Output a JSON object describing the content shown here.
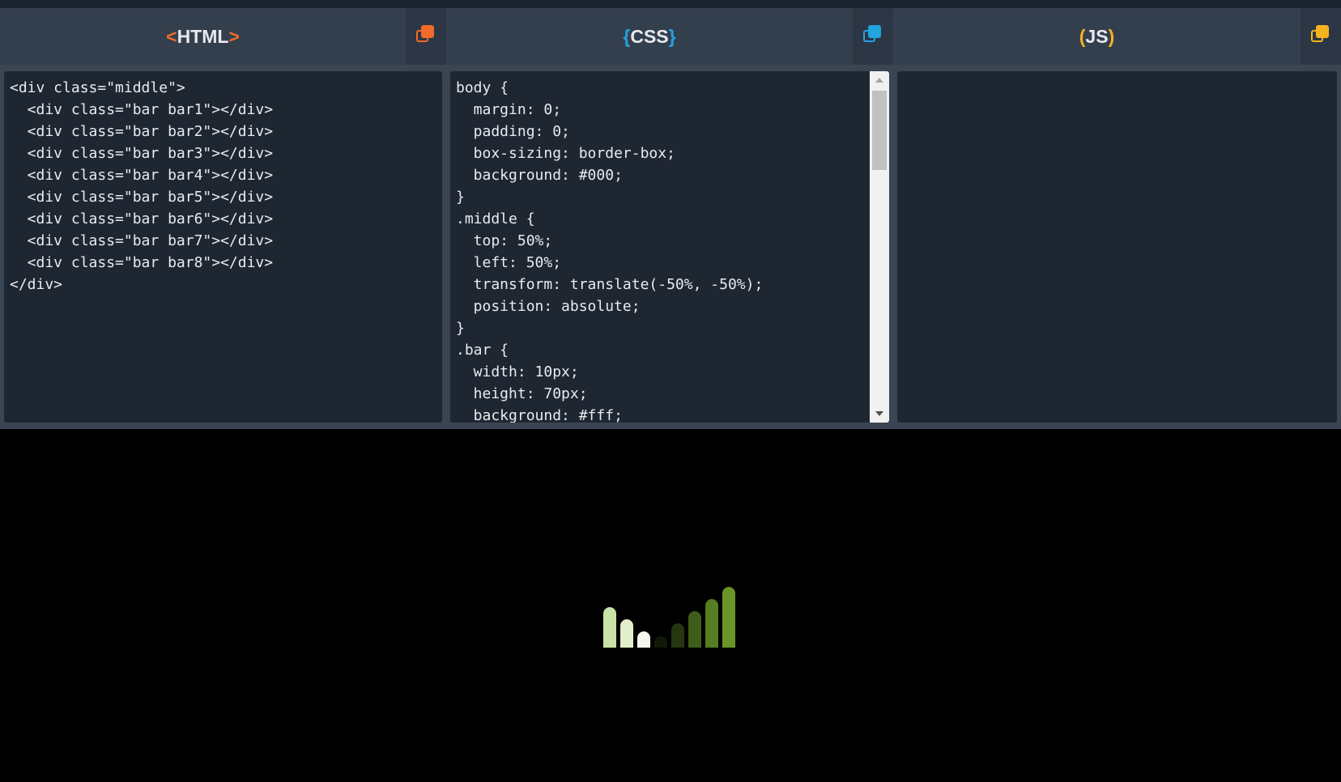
{
  "editors": {
    "html": {
      "title_open": "<",
      "title": "HTML",
      "title_close": ">",
      "code": "<div class=\"middle\">\n  <div class=\"bar bar1\"></div>\n  <div class=\"bar bar2\"></div>\n  <div class=\"bar bar3\"></div>\n  <div class=\"bar bar4\"></div>\n  <div class=\"bar bar5\"></div>\n  <div class=\"bar bar6\"></div>\n  <div class=\"bar bar7\"></div>\n  <div class=\"bar bar8\"></div>\n</div>"
    },
    "css": {
      "title_open": "{",
      "title": "CSS",
      "title_close": "}",
      "code": "body {\n  margin: 0;\n  padding: 0;\n  box-sizing: border-box;\n  background: #000;\n}\n.middle {\n  top: 50%;\n  left: 50%;\n  transform: translate(-50%, -50%);\n  position: absolute;\n}\n.bar {\n  width: 10px;\n  height: 70px;\n  background: #fff;"
    },
    "js": {
      "title_open": "(",
      "title": "JS",
      "title_close": ")",
      "code": ""
    }
  },
  "icons": {
    "copy": "copy-icon"
  },
  "colors": {
    "html_accent": "#f06a2a",
    "css_accent": "#21a4e0",
    "js_accent": "#f5b320"
  },
  "preview": {
    "bars": [
      {
        "level": 0.62,
        "color": "#c9e2a8"
      },
      {
        "level": 0.44,
        "color": "#e2eecc"
      },
      {
        "level": 0.25,
        "color": "#f6f8ee"
      },
      {
        "level": 0.17,
        "color": "#101a08"
      },
      {
        "level": 0.38,
        "color": "#24370f"
      },
      {
        "level": 0.56,
        "color": "#3f5d1a"
      },
      {
        "level": 0.75,
        "color": "#557e22"
      },
      {
        "level": 0.94,
        "color": "#6a9428"
      }
    ]
  }
}
